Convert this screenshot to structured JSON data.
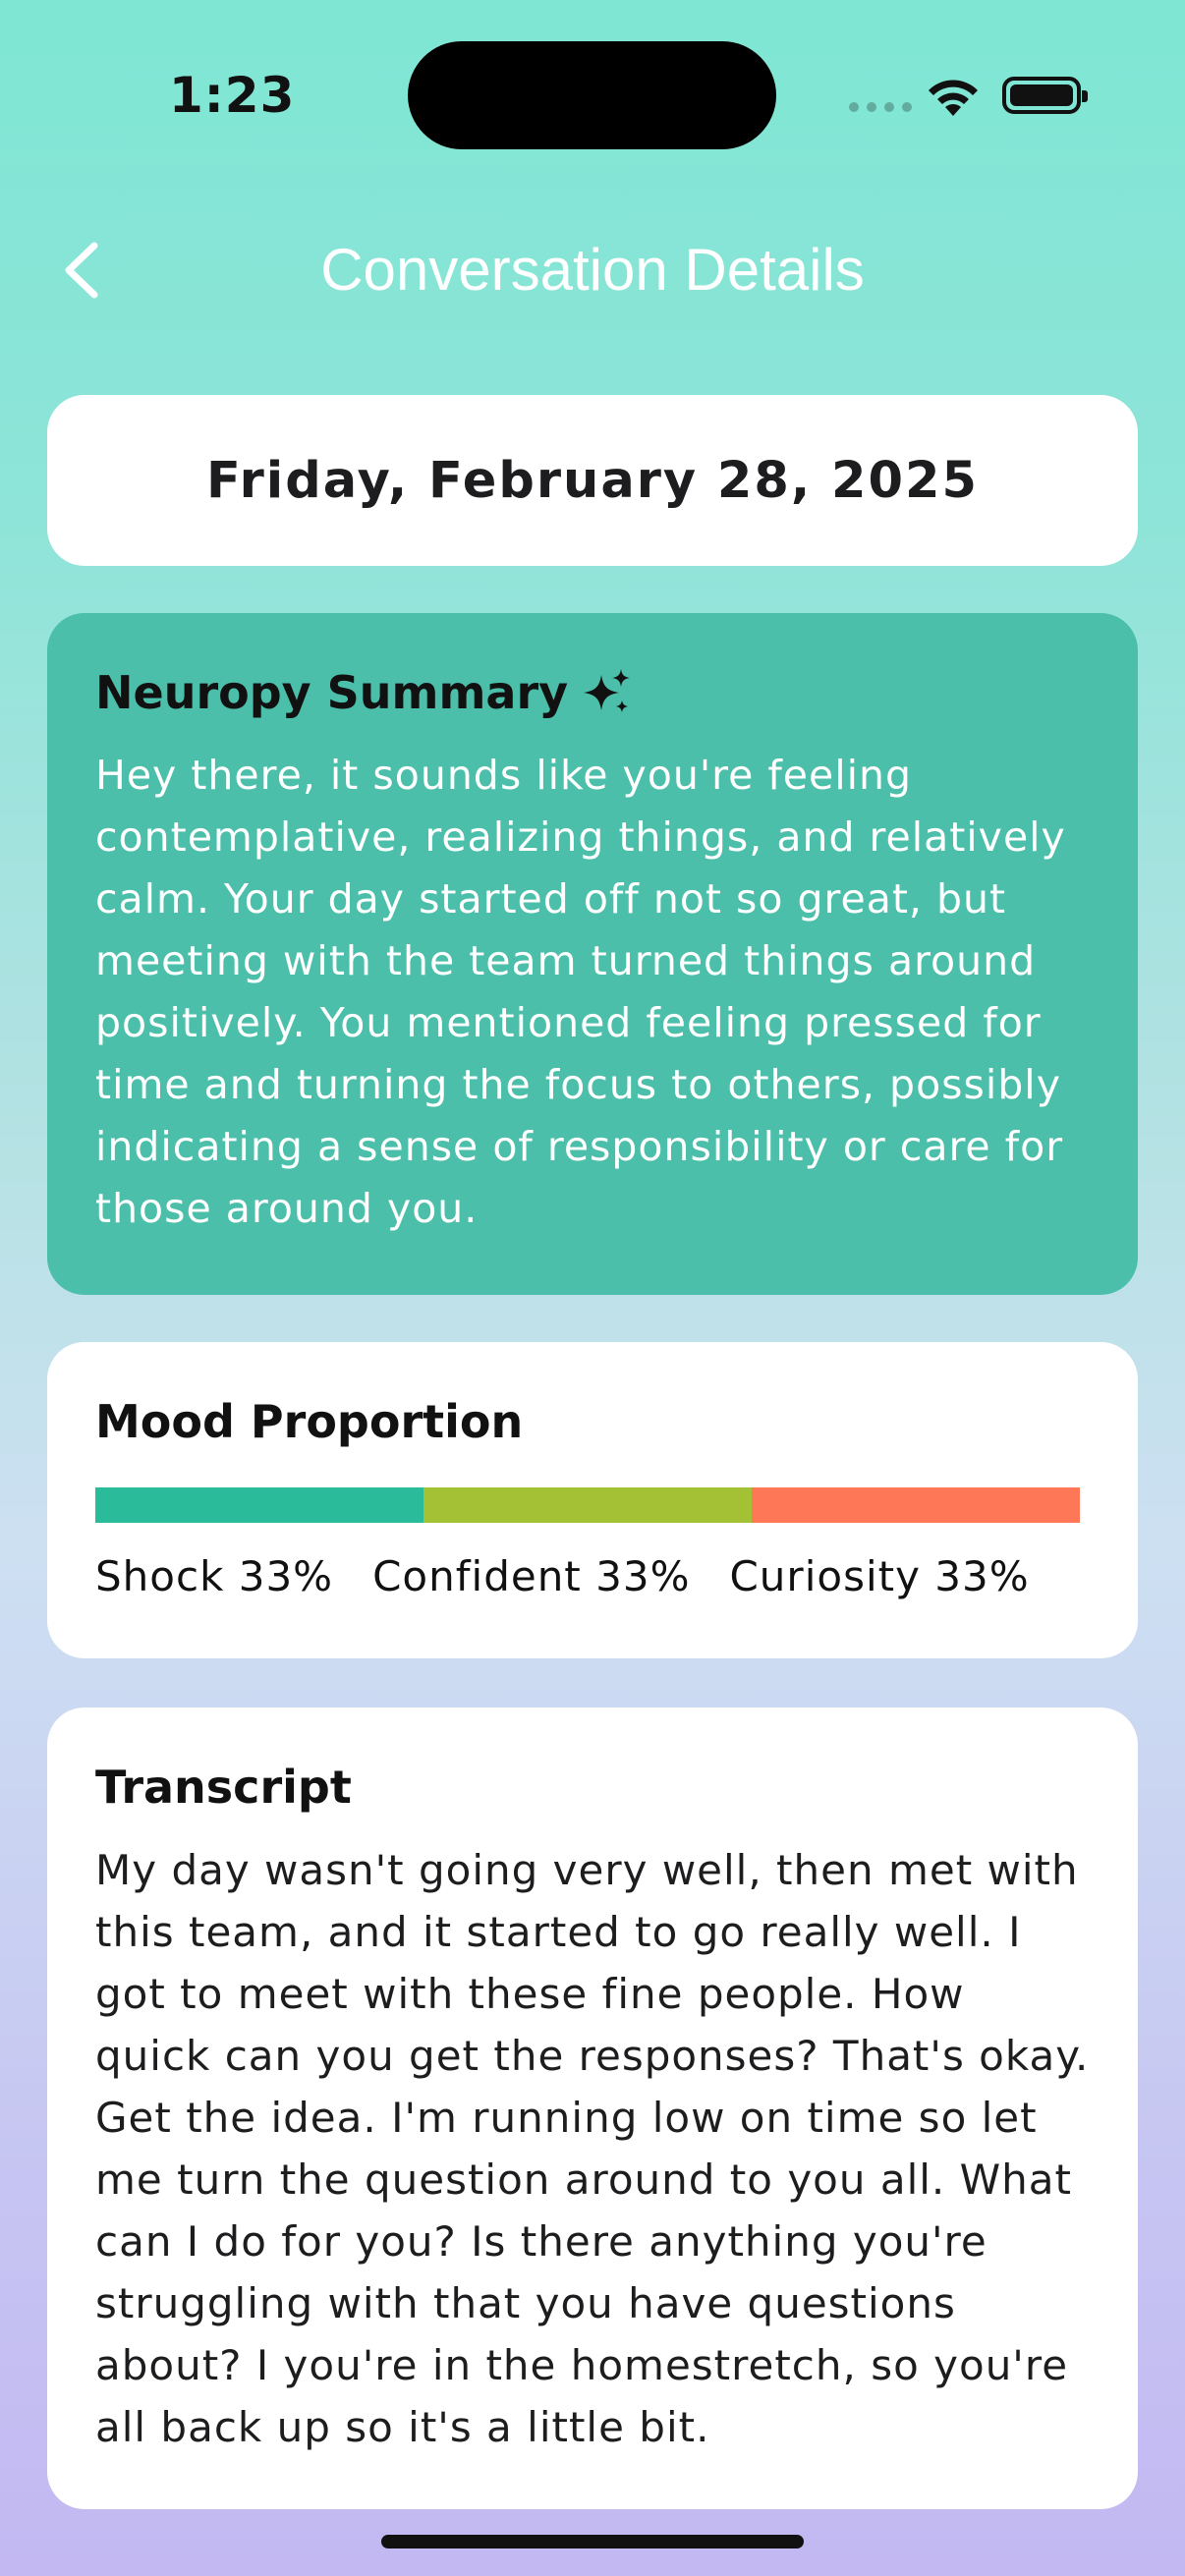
{
  "status_bar": {
    "time": "1:23"
  },
  "nav": {
    "title": "Conversation Details",
    "back_icon": "chevron-left-icon"
  },
  "date_card": {
    "date": "Friday, February 28, 2025"
  },
  "summary": {
    "heading": "Neuropy Summary",
    "icon": "sparkles-icon",
    "text": "Hey there, it sounds like you're feeling contemplative, realizing things, and relatively calm. Your day started off not so great, but meeting with the team turned things around positively. You mentioned feeling pressed for time and turning the focus to others, possibly indicating a sense of responsibility or care for those around you.",
    "background_color": "#4bbfaa"
  },
  "mood": {
    "heading": "Mood Proportion",
    "segments": [
      {
        "label": "Shock 33%",
        "fraction": 0.33,
        "color": "#2abb9b"
      },
      {
        "label": "Confident 33%",
        "fraction": 0.33,
        "color": "#a4c136"
      },
      {
        "label": "Curiosity 33%",
        "fraction": 0.33,
        "color": "#fe7858"
      }
    ]
  },
  "transcript": {
    "heading": "Transcript",
    "text": "My day wasn't going very well, then met with this team, and it started to go really well. I got to meet with these fine people. How quick can you get the responses? That's okay. Get the idea. I'm running low on time so let me turn the question around to you all. What can I do for you? Is there anything you're struggling with that you have questions about? I you're in the homestretch, so you're all back up so it's a little bit."
  }
}
